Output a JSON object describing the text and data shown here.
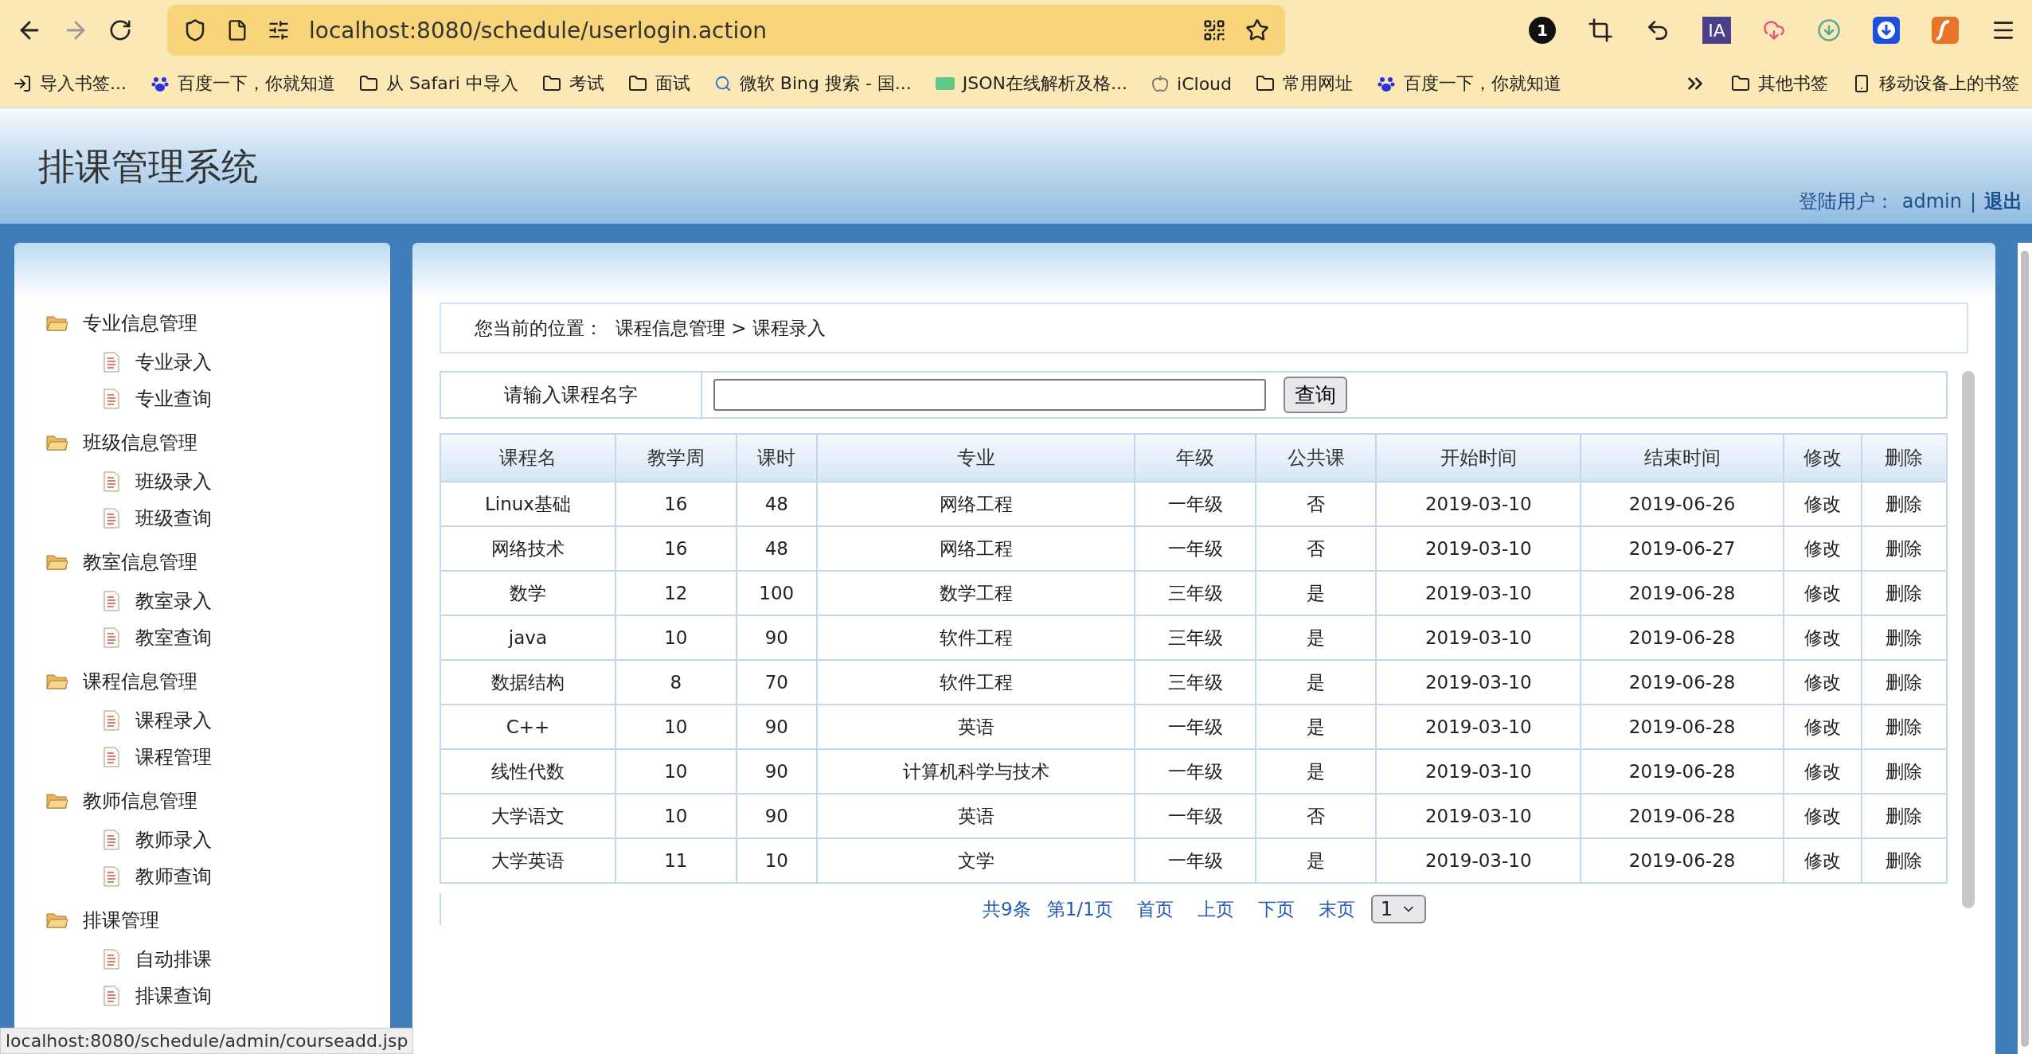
{
  "browser": {
    "url": "localhost:8080/schedule/userlogin.action",
    "extension_badge": "1",
    "extension_ia": "IA",
    "bookmarks": [
      {
        "kind": "import",
        "label": "导入书签..."
      },
      {
        "kind": "paw",
        "label": "百度一下，你就知道"
      },
      {
        "kind": "folder",
        "label": "从 Safari 中导入"
      },
      {
        "kind": "folder",
        "label": "考试"
      },
      {
        "kind": "folder",
        "label": "面试"
      },
      {
        "kind": "search",
        "label": "微软 Bing 搜索 - 国..."
      },
      {
        "kind": "json",
        "label": "JSON在线解析及格..."
      },
      {
        "kind": "apple",
        "label": "iCloud"
      },
      {
        "kind": "folder",
        "label": "常用网址"
      },
      {
        "kind": "paw",
        "label": "百度一下，你就知道"
      }
    ],
    "bookmarks_right": [
      {
        "kind": "folder",
        "label": "其他书签"
      },
      {
        "kind": "phone",
        "label": "移动设备上的书签"
      }
    ]
  },
  "header": {
    "title": "排课管理系统",
    "login_label": "登陆用户：",
    "user": "admin",
    "separator": "|",
    "logout": "退出"
  },
  "sidebar": {
    "groups": [
      {
        "label": "专业信息管理",
        "children": [
          {
            "label": "专业录入"
          },
          {
            "label": "专业查询"
          }
        ]
      },
      {
        "label": "班级信息管理",
        "children": [
          {
            "label": "班级录入"
          },
          {
            "label": "班级查询"
          }
        ]
      },
      {
        "label": "教室信息管理",
        "children": [
          {
            "label": "教室录入"
          },
          {
            "label": "教室查询"
          }
        ]
      },
      {
        "label": "课程信息管理",
        "children": [
          {
            "label": "课程录入"
          },
          {
            "label": "课程管理"
          }
        ]
      },
      {
        "label": "教师信息管理",
        "children": [
          {
            "label": "教师录入"
          },
          {
            "label": "教师查询"
          }
        ]
      },
      {
        "label": "排课管理",
        "children": [
          {
            "label": "自动排课"
          },
          {
            "label": "排课查询"
          }
        ]
      }
    ]
  },
  "breadcrumb": {
    "label": "您当前的位置：",
    "path": "课程信息管理 > 课程录入"
  },
  "search": {
    "label": "请输入课程名字",
    "button": "查询"
  },
  "table": {
    "columns": [
      "课程名",
      "教学周",
      "课时",
      "专业",
      "年级",
      "公共课",
      "开始时间",
      "结束时间",
      "修改",
      "删除"
    ],
    "rows": [
      [
        "Linux基础",
        "16",
        "48",
        "网络工程",
        "一年级",
        "否",
        "2019-03-10",
        "2019-06-26",
        "修改",
        "删除"
      ],
      [
        "网络技术",
        "16",
        "48",
        "网络工程",
        "一年级",
        "否",
        "2019-03-10",
        "2019-06-27",
        "修改",
        "删除"
      ],
      [
        "数学",
        "12",
        "100",
        "数学工程",
        "三年级",
        "是",
        "2019-03-10",
        "2019-06-28",
        "修改",
        "删除"
      ],
      [
        "java",
        "10",
        "90",
        "软件工程",
        "三年级",
        "是",
        "2019-03-10",
        "2019-06-28",
        "修改",
        "删除"
      ],
      [
        "数据结构",
        "8",
        "70",
        "软件工程",
        "三年级",
        "是",
        "2019-03-10",
        "2019-06-28",
        "修改",
        "删除"
      ],
      [
        "C++",
        "10",
        "90",
        "英语",
        "一年级",
        "是",
        "2019-03-10",
        "2019-06-28",
        "修改",
        "删除"
      ],
      [
        "线性代数",
        "10",
        "90",
        "计算机科学与技术",
        "一年级",
        "是",
        "2019-03-10",
        "2019-06-28",
        "修改",
        "删除"
      ],
      [
        "大学语文",
        "10",
        "90",
        "英语",
        "一年级",
        "否",
        "2019-03-10",
        "2019-06-28",
        "修改",
        "删除"
      ],
      [
        "大学英语",
        "11",
        "10",
        "文学",
        "一年级",
        "是",
        "2019-03-10",
        "2019-06-28",
        "修改",
        "删除"
      ]
    ]
  },
  "pagination": {
    "total": "共9条",
    "page": "第1/1页",
    "links": [
      "首页",
      "上页",
      "下页",
      "末页"
    ],
    "select": "1"
  },
  "status_bar": "localhost:8080/schedule/admin/courseadd.jsp"
}
